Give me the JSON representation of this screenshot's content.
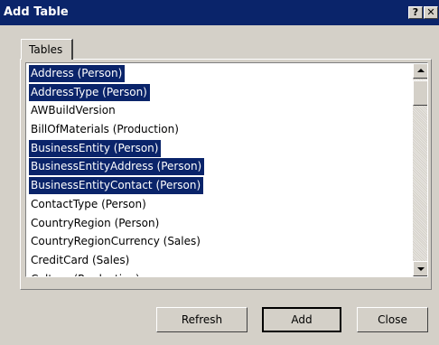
{
  "window": {
    "title": "Add Table",
    "help_label": "?",
    "close_label": "✕"
  },
  "tabs": [
    {
      "label": "Tables",
      "active": true
    }
  ],
  "tables_list": {
    "items": [
      {
        "label": "Address (Person)",
        "selected": true
      },
      {
        "label": "AddressType (Person)",
        "selected": true
      },
      {
        "label": "AWBuildVersion",
        "selected": false
      },
      {
        "label": "BillOfMaterials (Production)",
        "selected": false
      },
      {
        "label": "BusinessEntity (Person)",
        "selected": true
      },
      {
        "label": "BusinessEntityAddress (Person)",
        "selected": true
      },
      {
        "label": "BusinessEntityContact (Person)",
        "selected": true
      },
      {
        "label": "ContactType (Person)",
        "selected": false
      },
      {
        "label": "CountryRegion (Person)",
        "selected": false
      },
      {
        "label": "CountryRegionCurrency (Sales)",
        "selected": false
      },
      {
        "label": "CreditCard (Sales)",
        "selected": false
      },
      {
        "label": "Culture (Production)",
        "selected": false
      }
    ]
  },
  "buttons": {
    "refresh": "Refresh",
    "add": "Add",
    "close": "Close"
  },
  "colors": {
    "titlebar": "#0a246a",
    "selection": "#0a246a",
    "dialog_bg": "#d4d0c8"
  }
}
